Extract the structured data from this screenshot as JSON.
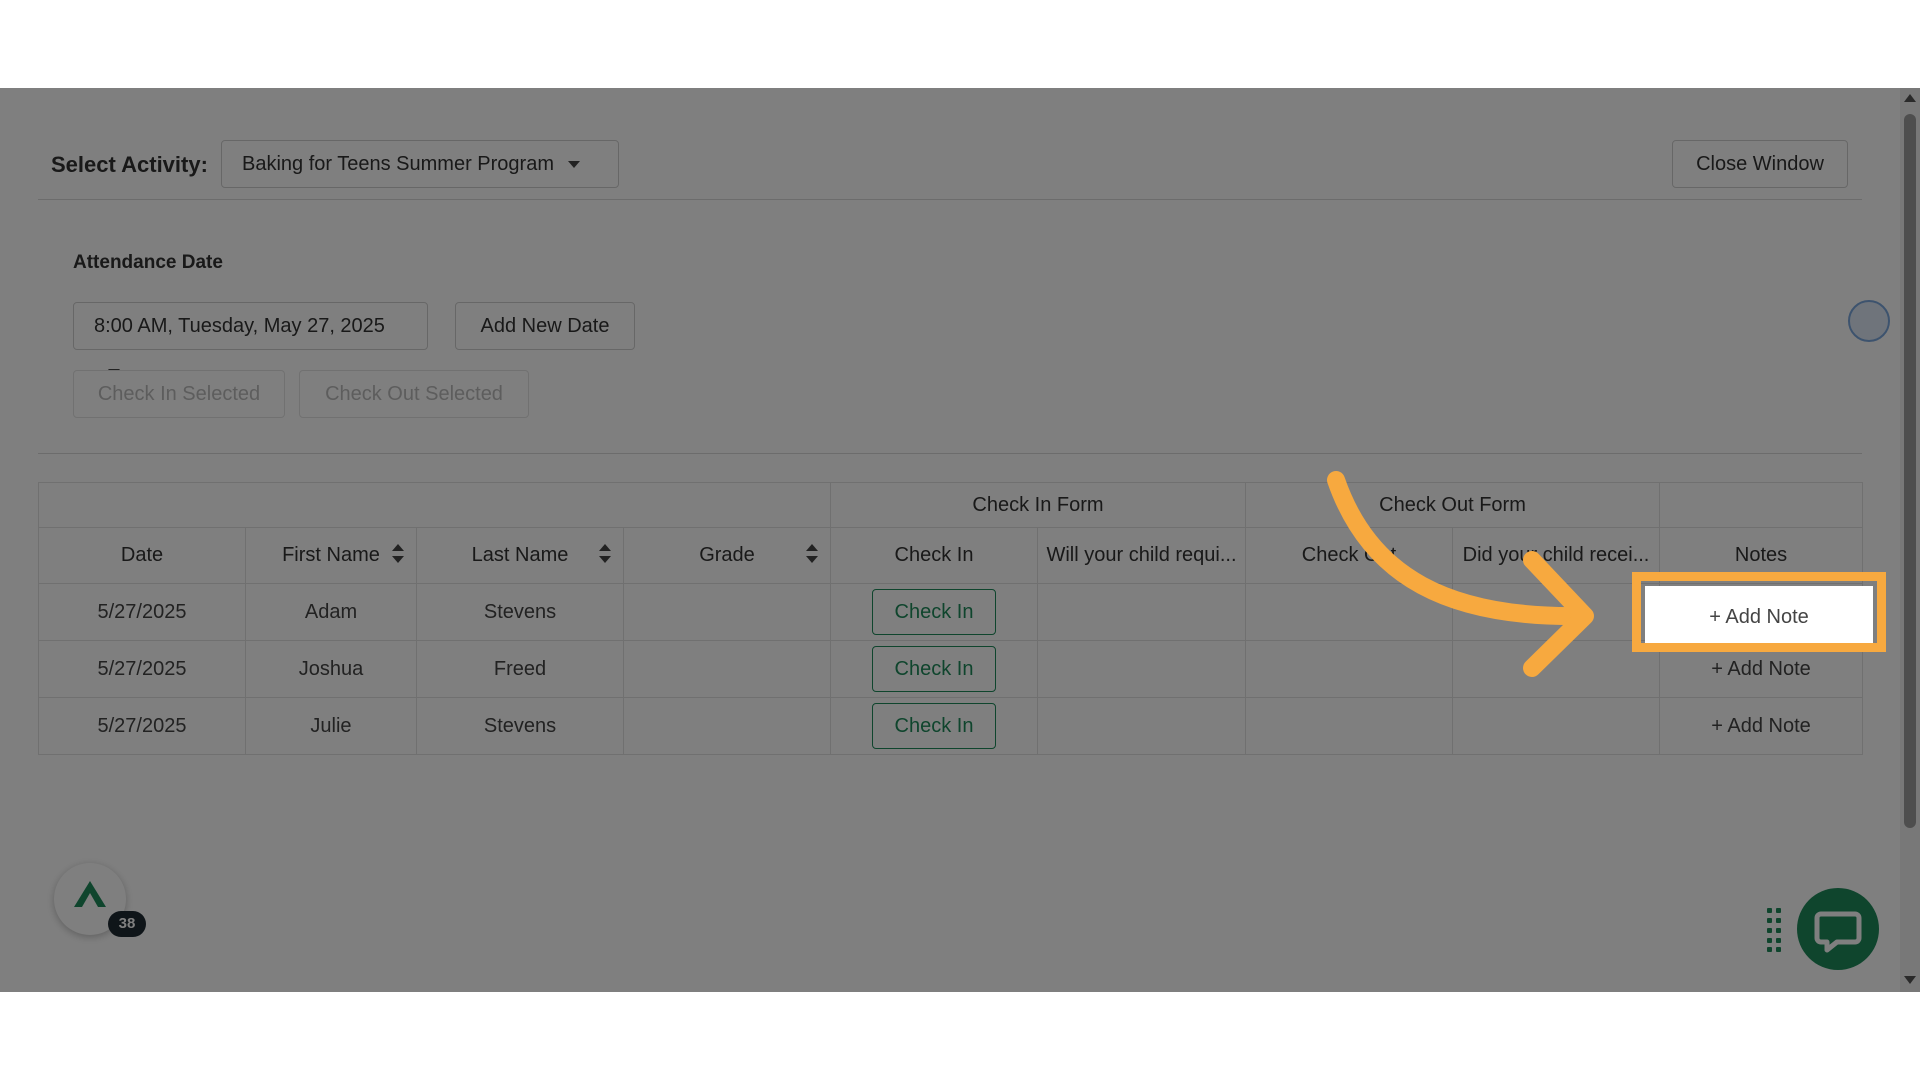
{
  "header": {
    "select_label": "Select Activity:",
    "activity_value": "Baking for Teens Summer Program",
    "close_label": "Close Window"
  },
  "attendance": {
    "label": "Attendance Date",
    "date_value": "8:00 AM, Tuesday, May 27, 2025",
    "add_date_label": "Add New Date",
    "check_in_selected": "Check In Selected",
    "check_out_selected": "Check Out Selected"
  },
  "table": {
    "groups": {
      "check_in_form": "Check In Form",
      "check_out_form": "Check Out Form"
    },
    "columns": {
      "date": "Date",
      "first_name": "First Name",
      "last_name": "Last Name",
      "grade": "Grade",
      "check_in": "Check In",
      "will_require": "Will your child requi...",
      "check_out": "Check Out",
      "did_receive": "Did your child recei...",
      "notes": "Notes"
    },
    "rows": [
      {
        "date": "5/27/2025",
        "first": "Adam",
        "last": "Stevens",
        "grade": "",
        "check_in": "Check In",
        "note": "+ Add Note"
      },
      {
        "date": "5/27/2025",
        "first": "Joshua",
        "last": "Freed",
        "grade": "",
        "check_in": "Check In",
        "note": "+ Add Note"
      },
      {
        "date": "5/27/2025",
        "first": "Julie",
        "last": "Stevens",
        "grade": "",
        "check_in": "Check In",
        "note": "+ Add Note"
      }
    ]
  },
  "widgets": {
    "badge_count": "38"
  },
  "colors": {
    "accent": "#1f8a5b",
    "highlight": "#f7a93f",
    "overlay": "#000000"
  }
}
